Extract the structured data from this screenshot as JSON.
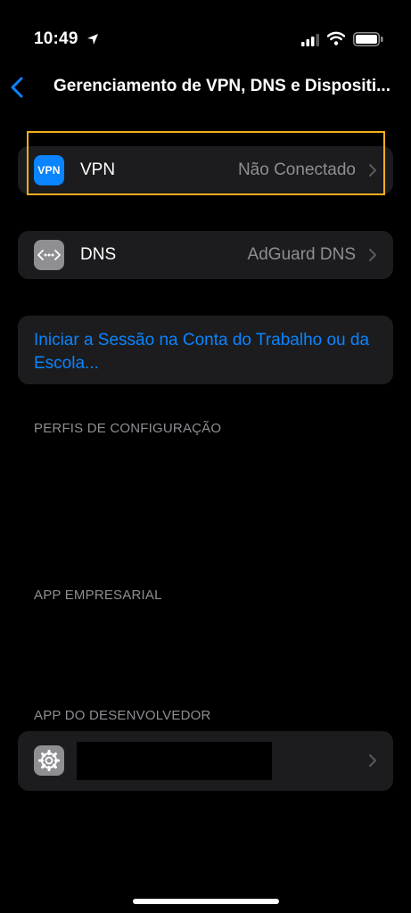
{
  "status_bar": {
    "time": "10:49"
  },
  "nav": {
    "title": "Gerenciamento de VPN, DNS e Dispositi..."
  },
  "rows": {
    "vpn": {
      "icon_text": "VPN",
      "label": "VPN",
      "value": "Não Conectado"
    },
    "dns": {
      "label": "DNS",
      "value": "AdGuard DNS"
    }
  },
  "work_account": {
    "link": "Iniciar a Sessão na Conta do Trabalho ou da Escola..."
  },
  "sections": {
    "config_profiles": "PERFIS DE CONFIGURAÇÃO",
    "enterprise_app": "APP EMPRESARIAL",
    "developer_app": "APP DO DESENVOLVEDOR"
  },
  "colors": {
    "accent": "#0a84ff",
    "vpn_icon_bg": "#0a84ff",
    "highlight": "#f6ae1e",
    "cell_bg": "#1c1c1e",
    "secondary_text": "#8e8e93"
  },
  "icons": {
    "dns": "network-dots-icon",
    "developer_app": "gear-icon"
  }
}
